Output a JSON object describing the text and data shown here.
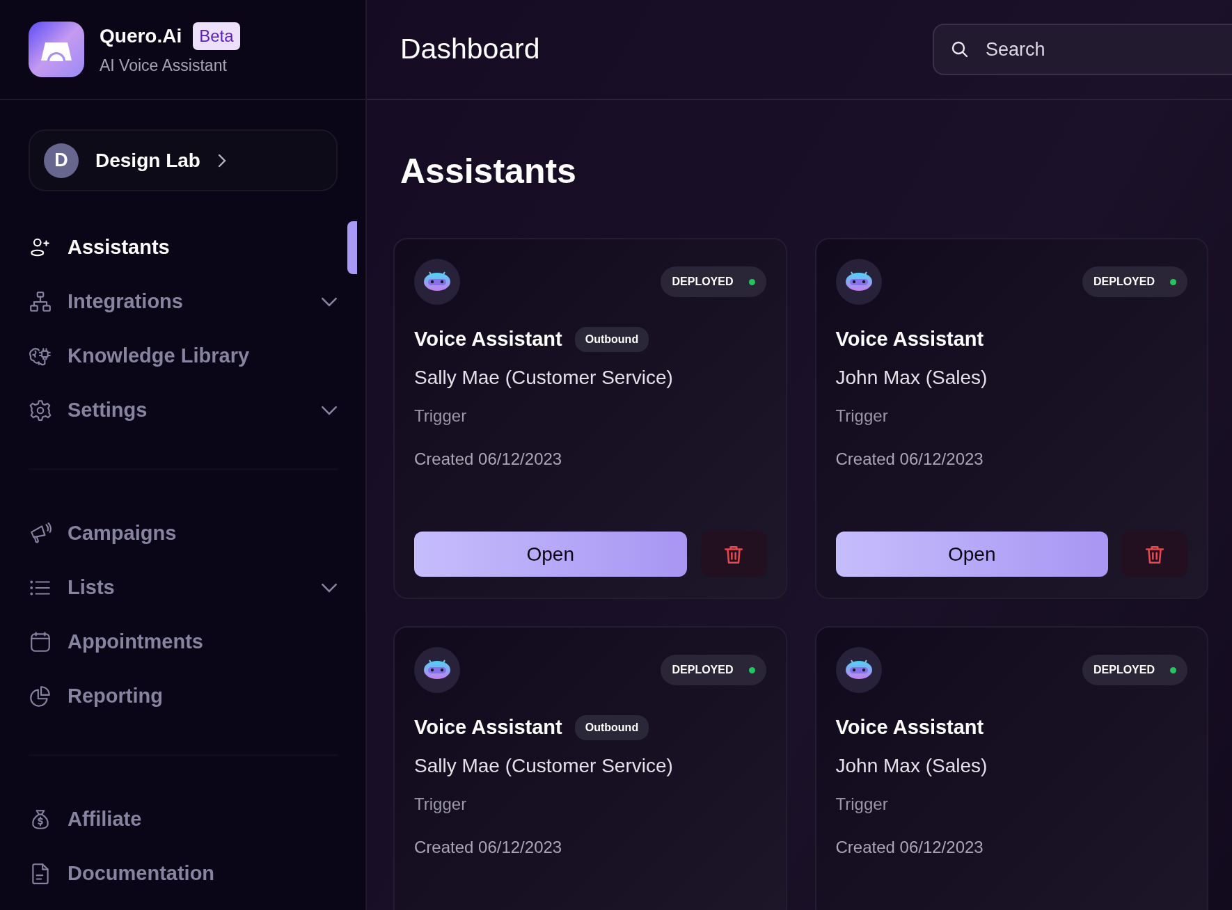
{
  "brand": {
    "name": "Quero.Ai",
    "badge": "Beta",
    "tagline": "AI Voice Assistant"
  },
  "workspace": {
    "initial": "D",
    "name": "Design Lab"
  },
  "sidebar": {
    "sections": [
      {
        "items": [
          {
            "label": "Assistants",
            "selected": true,
            "expandable": false
          },
          {
            "label": "Integrations",
            "selected": false,
            "expandable": true
          },
          {
            "label": "Knowledge Library",
            "selected": false,
            "expandable": false
          },
          {
            "label": "Settings",
            "selected": false,
            "expandable": true
          }
        ]
      },
      {
        "items": [
          {
            "label": "Campaigns",
            "selected": false,
            "expandable": false
          },
          {
            "label": "Lists",
            "selected": false,
            "expandable": true
          },
          {
            "label": "Appointments",
            "selected": false,
            "expandable": false
          },
          {
            "label": "Reporting",
            "selected": false,
            "expandable": false
          }
        ]
      },
      {
        "items": [
          {
            "label": "Affiliate",
            "selected": false,
            "expandable": false
          },
          {
            "label": "Documentation",
            "selected": false,
            "expandable": false
          }
        ]
      }
    ]
  },
  "header": {
    "title": "Dashboard",
    "search": {
      "placeholder": "Search"
    }
  },
  "section_title": "Assistants",
  "assistants": [
    {
      "title": "Voice Assistant",
      "tag": "Outbound",
      "name": "Sally Mae (Customer Service)",
      "trigger": "Trigger",
      "created": "Created 06/12/2023",
      "status": "DEPLOYED",
      "live": true,
      "open_label": "Open"
    },
    {
      "title": "Voice Assistant",
      "name": "John Max (Sales)",
      "trigger": "Trigger",
      "created": "Created 06/12/2023",
      "status": "DEPLOYED",
      "live": true,
      "open_label": "Open"
    },
    {
      "title": "Voice Assistant",
      "tag": "Outbound",
      "name": "Sally Mae (Customer Service)",
      "trigger": "Trigger",
      "created": "Created 06/12/2023",
      "status": "DEPLOYED",
      "live": true
    },
    {
      "title": "Voice Assistant",
      "name": "John Max (Sales)",
      "trigger": "Trigger",
      "created": "Created 06/12/2023",
      "status": "DEPLOYED",
      "live": true
    }
  ]
}
